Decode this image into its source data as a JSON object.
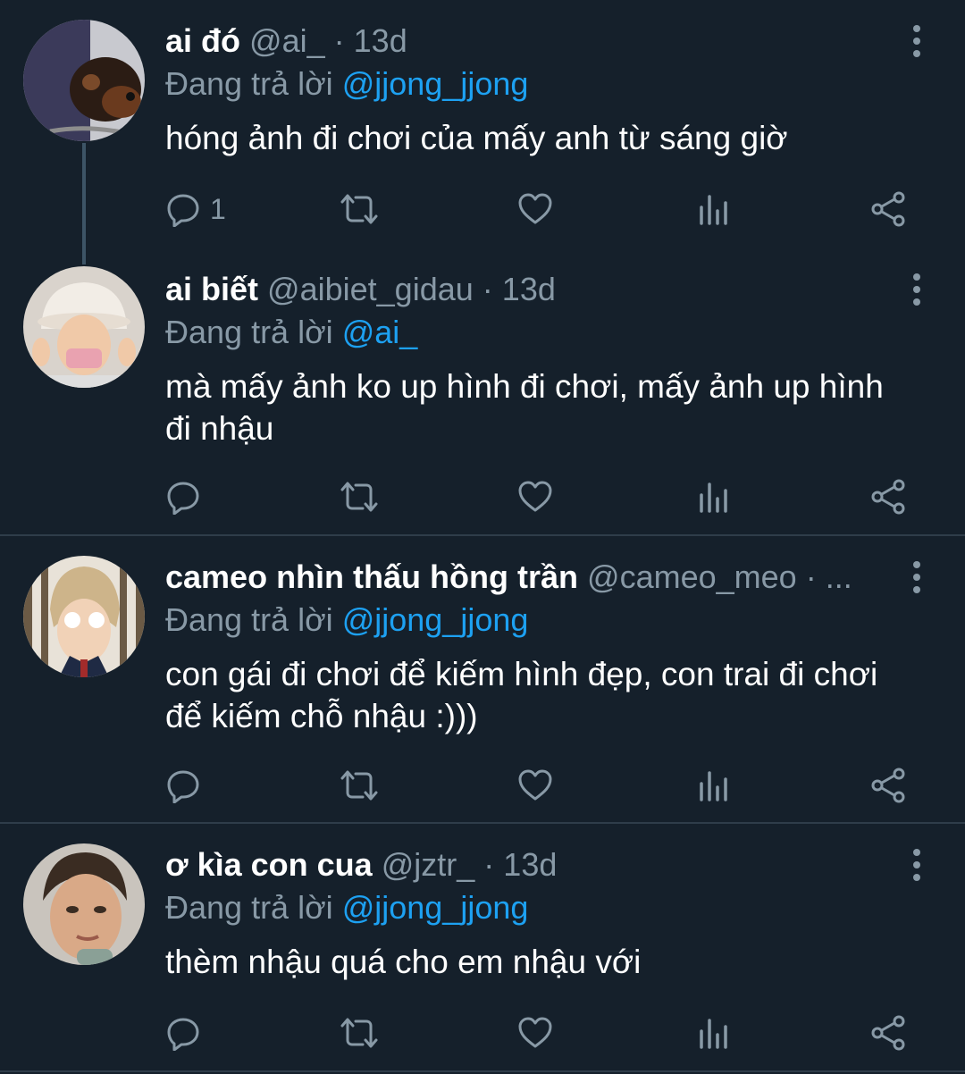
{
  "colors": {
    "background": "#15202b",
    "secondary_text": "#8899a6",
    "mention": "#1da1f2",
    "divider": "#2f3d4a"
  },
  "tweets": [
    {
      "name": "ai đó",
      "handle": "@ai_",
      "separator": "·",
      "time": "13d",
      "reply_prefix": "Đang trả lời",
      "reply_to": "@jjong_jjong",
      "text": "hóng ảnh đi chơi của mấy anh từ sáng giờ",
      "reply_count": "1",
      "avatar": "avatar-dog"
    },
    {
      "name": "ai biết",
      "handle": "@aibiet_gidau",
      "separator": "·",
      "time": "13d",
      "reply_prefix": "Đang trả lời",
      "reply_to": "@ai_",
      "text": "mà mấy ảnh ko up hình đi chơi, mấy ảnh up hình đi nhậu",
      "reply_count": "",
      "avatar": "avatar-bucket-hat"
    },
    {
      "name": "cameo nhìn thấu hồng trần",
      "handle": "@cameo_meo",
      "separator": "·",
      "time": "...",
      "reply_prefix": "Đang trả lời",
      "reply_to": "@jjong_jjong",
      "text": "con gái đi chơi để kiếm hình đẹp, con trai đi chơi để kiếm chỗ nhậu :)))",
      "reply_count": "",
      "avatar": "avatar-glasses"
    },
    {
      "name": "ơ kìa con cua",
      "handle": "@jztr_",
      "separator": "·",
      "time": "13d",
      "reply_prefix": "Đang trả lời",
      "reply_to": "@jjong_jjong",
      "text": "thèm nhậu quá cho em nhậu với",
      "reply_count": "",
      "avatar": "avatar-person"
    }
  ],
  "icons": {
    "reply": "reply-icon",
    "retweet": "retweet-icon",
    "like": "heart-icon",
    "stats": "analytics-icon",
    "share": "share-icon",
    "more": "more-vertical-icon"
  }
}
